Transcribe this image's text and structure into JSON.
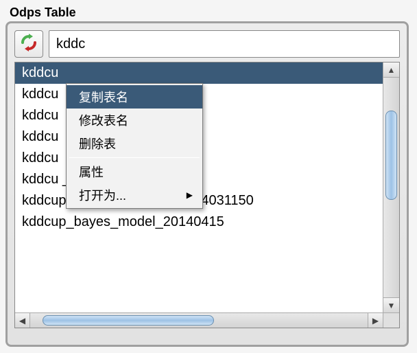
{
  "panel": {
    "title": "Odps Table"
  },
  "search": {
    "value": "kddc"
  },
  "list": {
    "items": [
      {
        "label": "kddcu",
        "selected": true
      },
      {
        "label": "kddcu",
        "selected": false
      },
      {
        "label": "kddcu",
        "selected": false
      },
      {
        "label": "kddcu",
        "selected": false
      },
      {
        "label": "kddcu",
        "selected": false
      },
      {
        "label": "kddcu                                  _predicted_out",
        "selected": false
      },
      {
        "label": "kddcup_bayes_model_201404031150",
        "selected": false
      },
      {
        "label": "kddcup_bayes_model_20140415",
        "selected": false
      }
    ]
  },
  "context_menu": {
    "visible": true,
    "items": [
      {
        "label": "复制表名",
        "highlight": true,
        "submenu": false
      },
      {
        "label": "修改表名",
        "highlight": false,
        "submenu": false
      },
      {
        "label": "删除表",
        "highlight": false,
        "submenu": false
      },
      {
        "sep": true
      },
      {
        "label": "属性",
        "highlight": false,
        "submenu": false
      },
      {
        "label": "打开为...",
        "highlight": false,
        "submenu": true
      }
    ]
  },
  "glyphs": {
    "arrow_up": "▲",
    "arrow_down": "▼",
    "arrow_left": "◀",
    "arrow_right": "▶"
  }
}
